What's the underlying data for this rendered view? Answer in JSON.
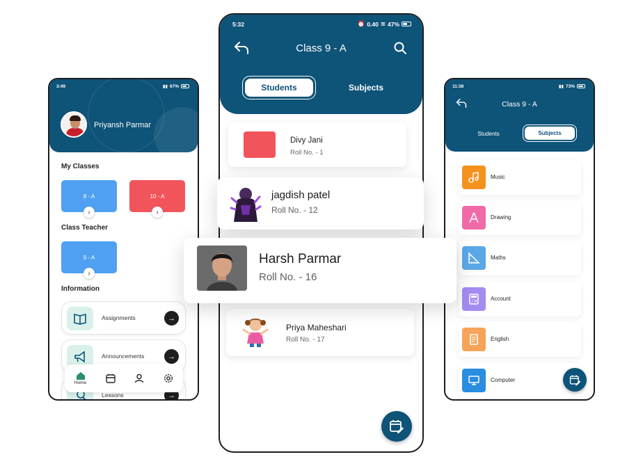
{
  "left_phone": {
    "status": {
      "time": "3:49",
      "battery": "67%"
    },
    "profile": {
      "name": "Priyansh Parmar"
    },
    "my_classes": {
      "heading": "My Classes",
      "tiles": [
        "8 - A",
        "10 - A"
      ]
    },
    "class_teacher": {
      "heading": "Class Teacher",
      "tile": "9 - A"
    },
    "information": {
      "heading": "Information",
      "items": [
        {
          "label": "Assignments",
          "icon": "book-icon"
        },
        {
          "label": "Announcements",
          "icon": "megaphone-icon"
        },
        {
          "label": "Lessons",
          "icon": "search-book-icon"
        }
      ]
    },
    "bottom_nav": {
      "home_label": "Home"
    }
  },
  "middle_phone": {
    "status": {
      "time": "5:32",
      "speed": "0.40",
      "battery": "47%"
    },
    "title": "Class 9 - A",
    "tabs": {
      "students": "Students",
      "subjects": "Subjects"
    },
    "students": [
      {
        "name": "Divy Jani",
        "roll": "Roll No. - 1",
        "avatar_color": "#f2545b"
      },
      {
        "name": "jagdish patel",
        "roll": "Roll No. - 12"
      },
      {
        "name": "Harsh Parmar",
        "roll": "Roll No. - 16"
      },
      {
        "name": "Priya Maheshari",
        "roll": "Roll No. - 17"
      }
    ]
  },
  "right_phone": {
    "status": {
      "time": "11:38",
      "battery": "73%"
    },
    "title": "Class 9 - A",
    "tabs": {
      "students": "Students",
      "subjects": "Subjects"
    },
    "subjects": [
      {
        "label": "Music",
        "color": "#f5921e"
      },
      {
        "label": "Drawing",
        "color": "#f06aa8"
      },
      {
        "label": "Maths",
        "color": "#5aa8ea"
      },
      {
        "label": "Account",
        "color": "#a48cf0"
      },
      {
        "label": "English",
        "color": "#f5a45a"
      },
      {
        "label": "Computer",
        "color": "#2a8de0"
      }
    ]
  },
  "colors": {
    "primary": "#0e5378",
    "tile_blue": "#4fa0f2",
    "tile_red": "#f2545b"
  }
}
